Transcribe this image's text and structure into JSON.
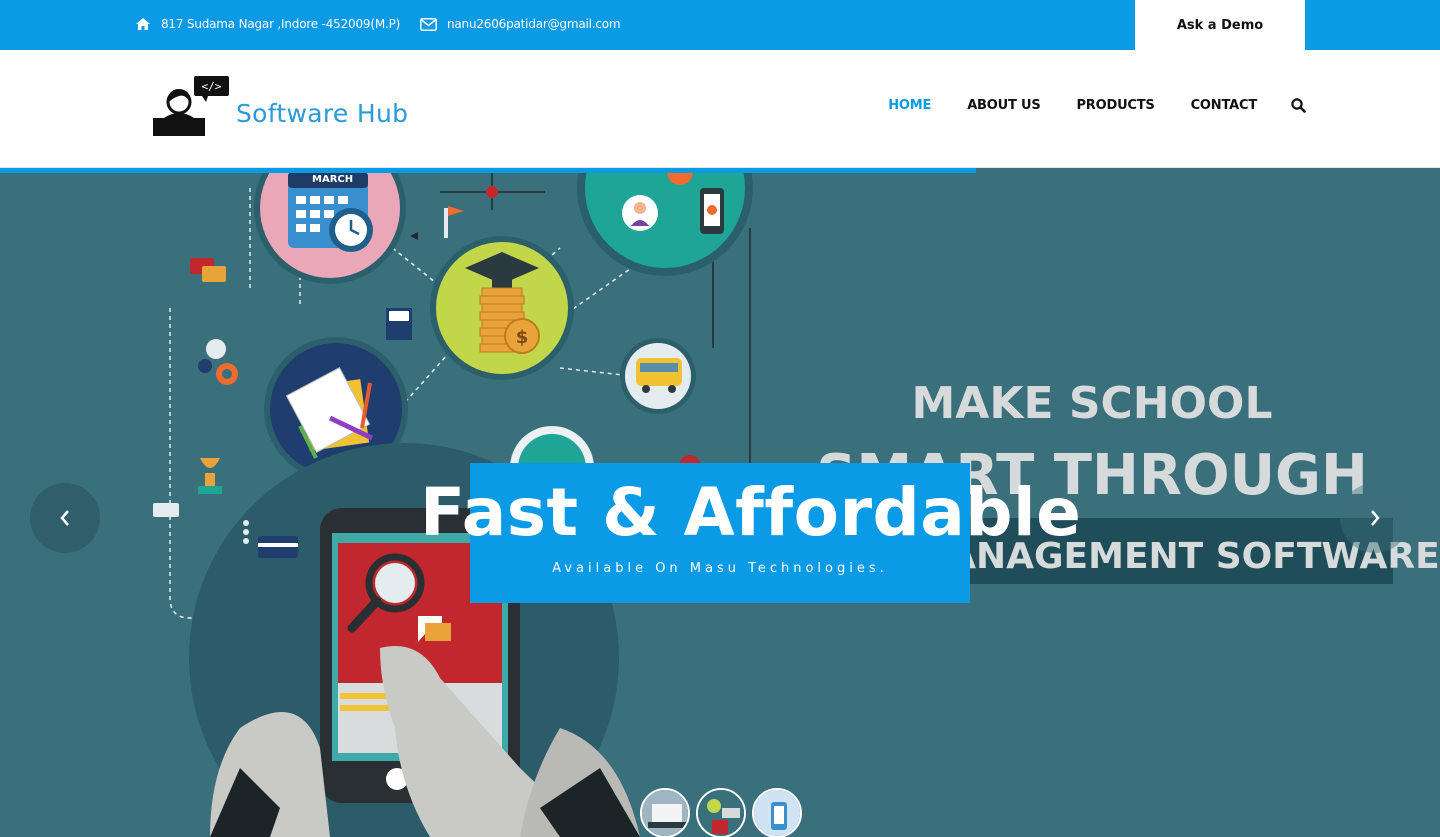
{
  "topbar": {
    "address": "817 Sudama Nagar ,Indore -452009(M.P)",
    "email": "nanu2606patidar@gmail.com",
    "demo_label": "Ask a Demo",
    "icons": [
      "home-icon",
      "envelope-icon"
    ]
  },
  "header": {
    "logo_text": "Software Hub",
    "logo_badge": "</>",
    "nav": [
      {
        "label": "HOME",
        "active": true
      },
      {
        "label": "ABOUT US",
        "active": false
      },
      {
        "label": "PRODUCTS",
        "active": false
      },
      {
        "label": "CONTACT",
        "active": false
      }
    ],
    "search_icon": "search-icon"
  },
  "slider": {
    "progress": 0.678,
    "caption_title": "Fast & Affordable",
    "caption_subtitle": "Available On Masu Technologies.",
    "banner_lines": [
      "MAKE SCHOOL",
      "SMART THROUGH",
      "MANAGEMENT SOFTWARE"
    ],
    "calendar_label": "MARCH",
    "prev_icon": "chevron-left-icon",
    "next_icon": "chevron-right-icon",
    "thumbnails": 3
  },
  "colors": {
    "accent": "#0b9ae6",
    "hero_bg": "#3a6f7c",
    "logo_text": "#2b9ad9"
  }
}
